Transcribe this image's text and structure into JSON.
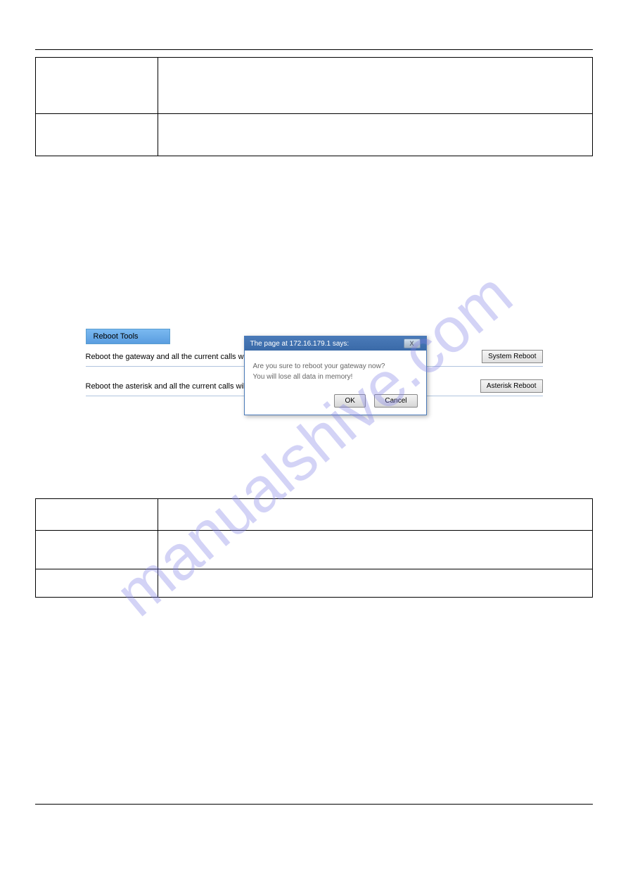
{
  "top_table": {
    "rows": [
      {
        "col1": "",
        "col2": ""
      },
      {
        "col1": "",
        "col2": ""
      }
    ]
  },
  "screenshot": {
    "panel_title": "Reboot Tools",
    "row1_text": "Reboot the gateway and all the current calls will be",
    "row1_button": "System Reboot",
    "row2_text": "Reboot the asterisk and all the current calls will be",
    "row2_button": "Asterisk Reboot",
    "dialog": {
      "title": "The page at 172.16.179.1 says:",
      "line1": "Are you sure to reboot your gateway now?",
      "line2": "You will lose all data in memory!",
      "ok": "OK",
      "cancel": "Cancel",
      "close": "X"
    }
  },
  "bottom_table": {
    "rows": [
      {
        "col1": "",
        "col2": ""
      },
      {
        "col1": "",
        "col2": ""
      },
      {
        "col1": "",
        "col2": ""
      }
    ]
  },
  "watermark": "manualshive.com"
}
